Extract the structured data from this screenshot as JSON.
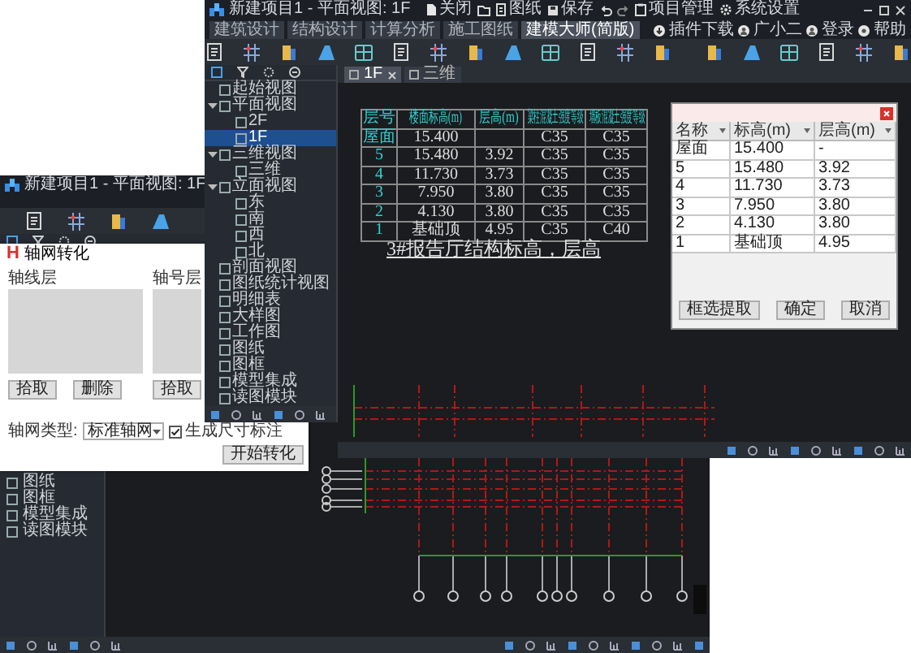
{
  "main_window": {
    "title": "新建项目1 - 平面视图: 1F",
    "tools": [
      {
        "kind": "doc",
        "label": "关闭"
      },
      {
        "kind": "folder"
      },
      {
        "kind": "sheet",
        "label": "图纸"
      },
      {
        "kind": "save",
        "label": "保存"
      },
      {
        "kind": "undo"
      },
      {
        "kind": "redo"
      },
      {
        "kind": "project",
        "label": "项目管理"
      },
      {
        "kind": "gear",
        "label": "系统设置"
      }
    ],
    "tabs": [
      {
        "label": "建筑设计",
        "selected": false
      },
      {
        "label": "结构设计",
        "selected": false
      },
      {
        "label": "计算分析",
        "selected": false
      },
      {
        "label": "施工图纸",
        "selected": false
      },
      {
        "label": "建模大师(简版)",
        "selected": true
      }
    ],
    "account_tools": [
      {
        "kind": "download",
        "label": "插件下载"
      },
      {
        "kind": "user",
        "label": "广小二"
      },
      {
        "kind": "user",
        "label": "登录"
      },
      {
        "kind": "help",
        "label": "帮助"
      }
    ],
    "view_tree": [
      {
        "label": "起始视图",
        "selected": false
      },
      {
        "label": "平面视图",
        "selected": false,
        "expanded": true,
        "children": [
          {
            "label": "2F",
            "selected": false
          },
          {
            "label": "1F",
            "selected": true
          }
        ]
      },
      {
        "label": "三维视图",
        "selected": false,
        "expanded": true,
        "children": [
          {
            "label": "三维",
            "selected": false
          }
        ]
      },
      {
        "label": "立面视图",
        "selected": false,
        "expanded": true,
        "children": [
          {
            "label": "东",
            "selected": false
          },
          {
            "label": "南",
            "selected": false
          },
          {
            "label": "西",
            "selected": false
          },
          {
            "label": "北",
            "selected": false
          }
        ]
      },
      {
        "label": "剖面视图",
        "selected": false
      },
      {
        "label": "图纸统计视图",
        "selected": false
      },
      {
        "label": "明细表",
        "selected": false
      },
      {
        "label": "大样图",
        "selected": false
      },
      {
        "label": "工作图",
        "selected": false
      },
      {
        "label": "图纸",
        "selected": false
      },
      {
        "label": "图框",
        "selected": false
      },
      {
        "label": "模型集成",
        "selected": false
      },
      {
        "label": "读图模块",
        "selected": false
      }
    ],
    "view_tabs": [
      {
        "label": "1F",
        "selected": true
      },
      {
        "label": "三维",
        "selected": false
      }
    ],
    "level_table": {
      "header": [
        "层号",
        "楼面标高(m)",
        "层高(m)",
        "梁柱混凝土强度等级",
        "墙板混凝土强度等级"
      ],
      "rows": [
        [
          "屋面",
          "15.400",
          null,
          "C35",
          "C35"
        ],
        [
          "5",
          "15.480",
          "3.92",
          "C35",
          "C35"
        ],
        [
          "4",
          "11.730",
          "3.73",
          "C35",
          "C35"
        ],
        [
          "3",
          "7.950",
          "3.80",
          "C35",
          "C35"
        ],
        [
          "2",
          "4.130",
          "3.80",
          "C35",
          "C35"
        ],
        [
          "1",
          "基础顶",
          "4.95",
          "C35",
          "C40"
        ]
      ]
    },
    "caption": "3#报告厅结构标高，层高",
    "floor_dialog": {
      "columns": [
        "名称",
        "标高(m)",
        "层高(m)"
      ],
      "rows": [
        [
          "屋面",
          "15.400",
          "-"
        ],
        [
          "5",
          "15.480",
          "3.92"
        ],
        [
          "4",
          "11.730",
          "3.73"
        ],
        [
          "3",
          "7.950",
          "3.80"
        ],
        [
          "2",
          "4.130",
          "3.80"
        ],
        [
          "1",
          "基础顶",
          "4.95"
        ]
      ],
      "buttons": [
        "框选提取",
        "确定",
        "取消"
      ]
    }
  },
  "back_window": {
    "title": "新建项目1 - 平面视图: 1F",
    "view_tree": [
      {
        "label": "图纸",
        "selected": false
      },
      {
        "label": "图框",
        "selected": false
      },
      {
        "label": "模型集成",
        "selected": false
      },
      {
        "label": "读图模块",
        "selected": false
      }
    ]
  },
  "grid_dialog": {
    "logo": "H",
    "title": "轴网转化",
    "axis_line_layer": {
      "label": "轴线层",
      "buttons": [
        "拾取",
        "删除"
      ]
    },
    "axis_label_layer": {
      "label": "轴号层",
      "buttons": [
        "拾取"
      ]
    },
    "grid_type_label": "轴网类型:",
    "grid_type": "标准轴网",
    "dimension_checkbox": {
      "label": "生成尺寸标注",
      "checked": true
    },
    "start_button": "开始转化"
  }
}
